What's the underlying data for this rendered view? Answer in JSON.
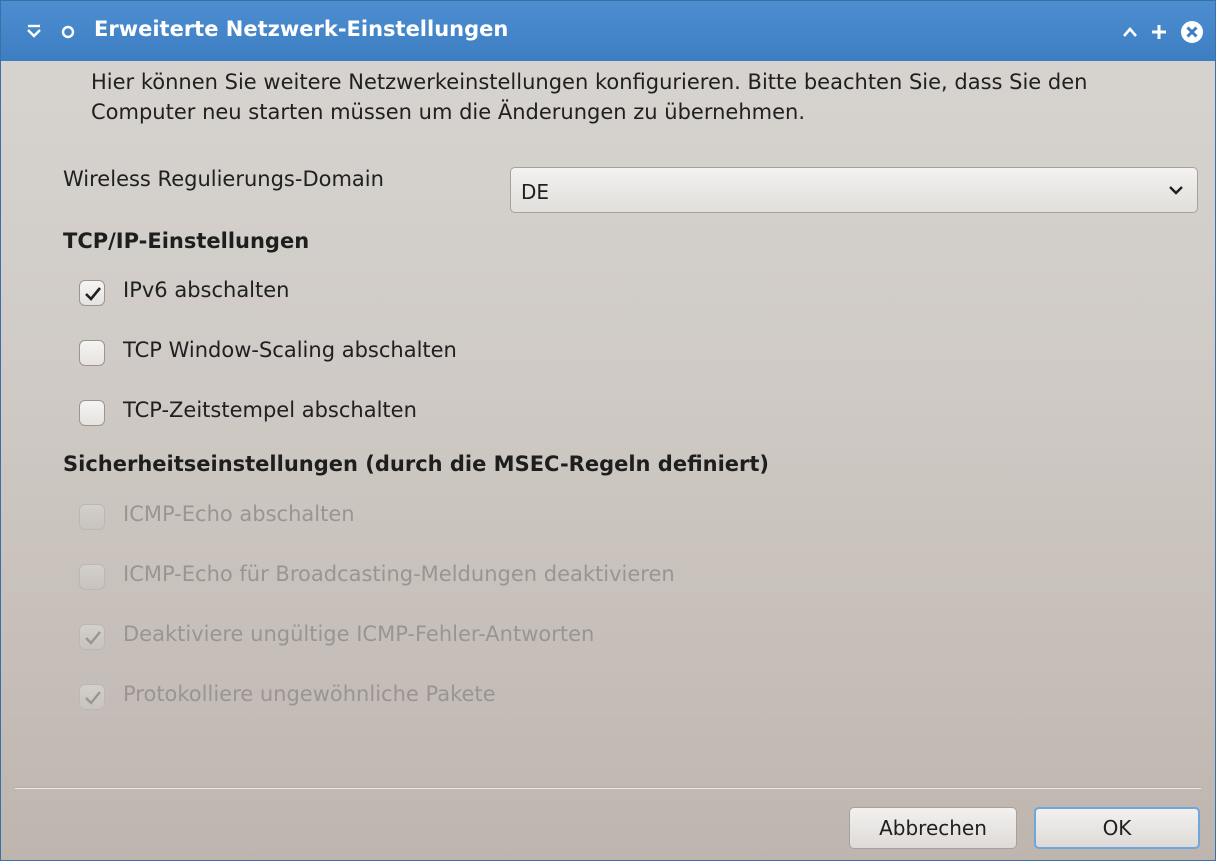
{
  "window": {
    "title": "Erweiterte Netzwerk-Einstellungen",
    "icons": [
      "shade-menu-icon",
      "pin-icon",
      "minimize-icon",
      "maximize-icon",
      "close-icon"
    ]
  },
  "intro_text": "Hier können Sie weitere Netzwerkeinstellungen konfigurieren. Bitte beachten Sie, dass Sie den Computer neu starten müssen um die Änderungen zu übernehmen.",
  "regulatory": {
    "label": "Wireless Regulierungs-Domain",
    "value": "DE"
  },
  "tcp_section": {
    "title": "TCP/IP-Einstellungen",
    "options": [
      {
        "label": "IPv6 abschalten",
        "checked": true,
        "enabled": true
      },
      {
        "label": "TCP Window-Scaling abschalten",
        "checked": false,
        "enabled": true
      },
      {
        "label": "TCP-Zeitstempel abschalten",
        "checked": false,
        "enabled": true
      }
    ]
  },
  "security_section": {
    "title": "Sicherheitseinstellungen (durch die MSEC-Regeln definiert)",
    "options": [
      {
        "label": "ICMP-Echo abschalten",
        "checked": false,
        "enabled": false
      },
      {
        "label": "ICMP-Echo für Broadcasting-Meldungen deaktivieren",
        "checked": false,
        "enabled": false
      },
      {
        "label": "Deaktiviere ungültige ICMP-Fehler-Antworten",
        "checked": true,
        "enabled": false
      },
      {
        "label": "Protokolliere ungewöhnliche Pakete",
        "checked": true,
        "enabled": false
      }
    ]
  },
  "buttons": {
    "cancel": "Abbrechen",
    "ok": "OK"
  },
  "colors": {
    "titlebar": "#3d7ec2",
    "window_bg": "#cfcac5",
    "focus_ring": "#6ea6de"
  }
}
